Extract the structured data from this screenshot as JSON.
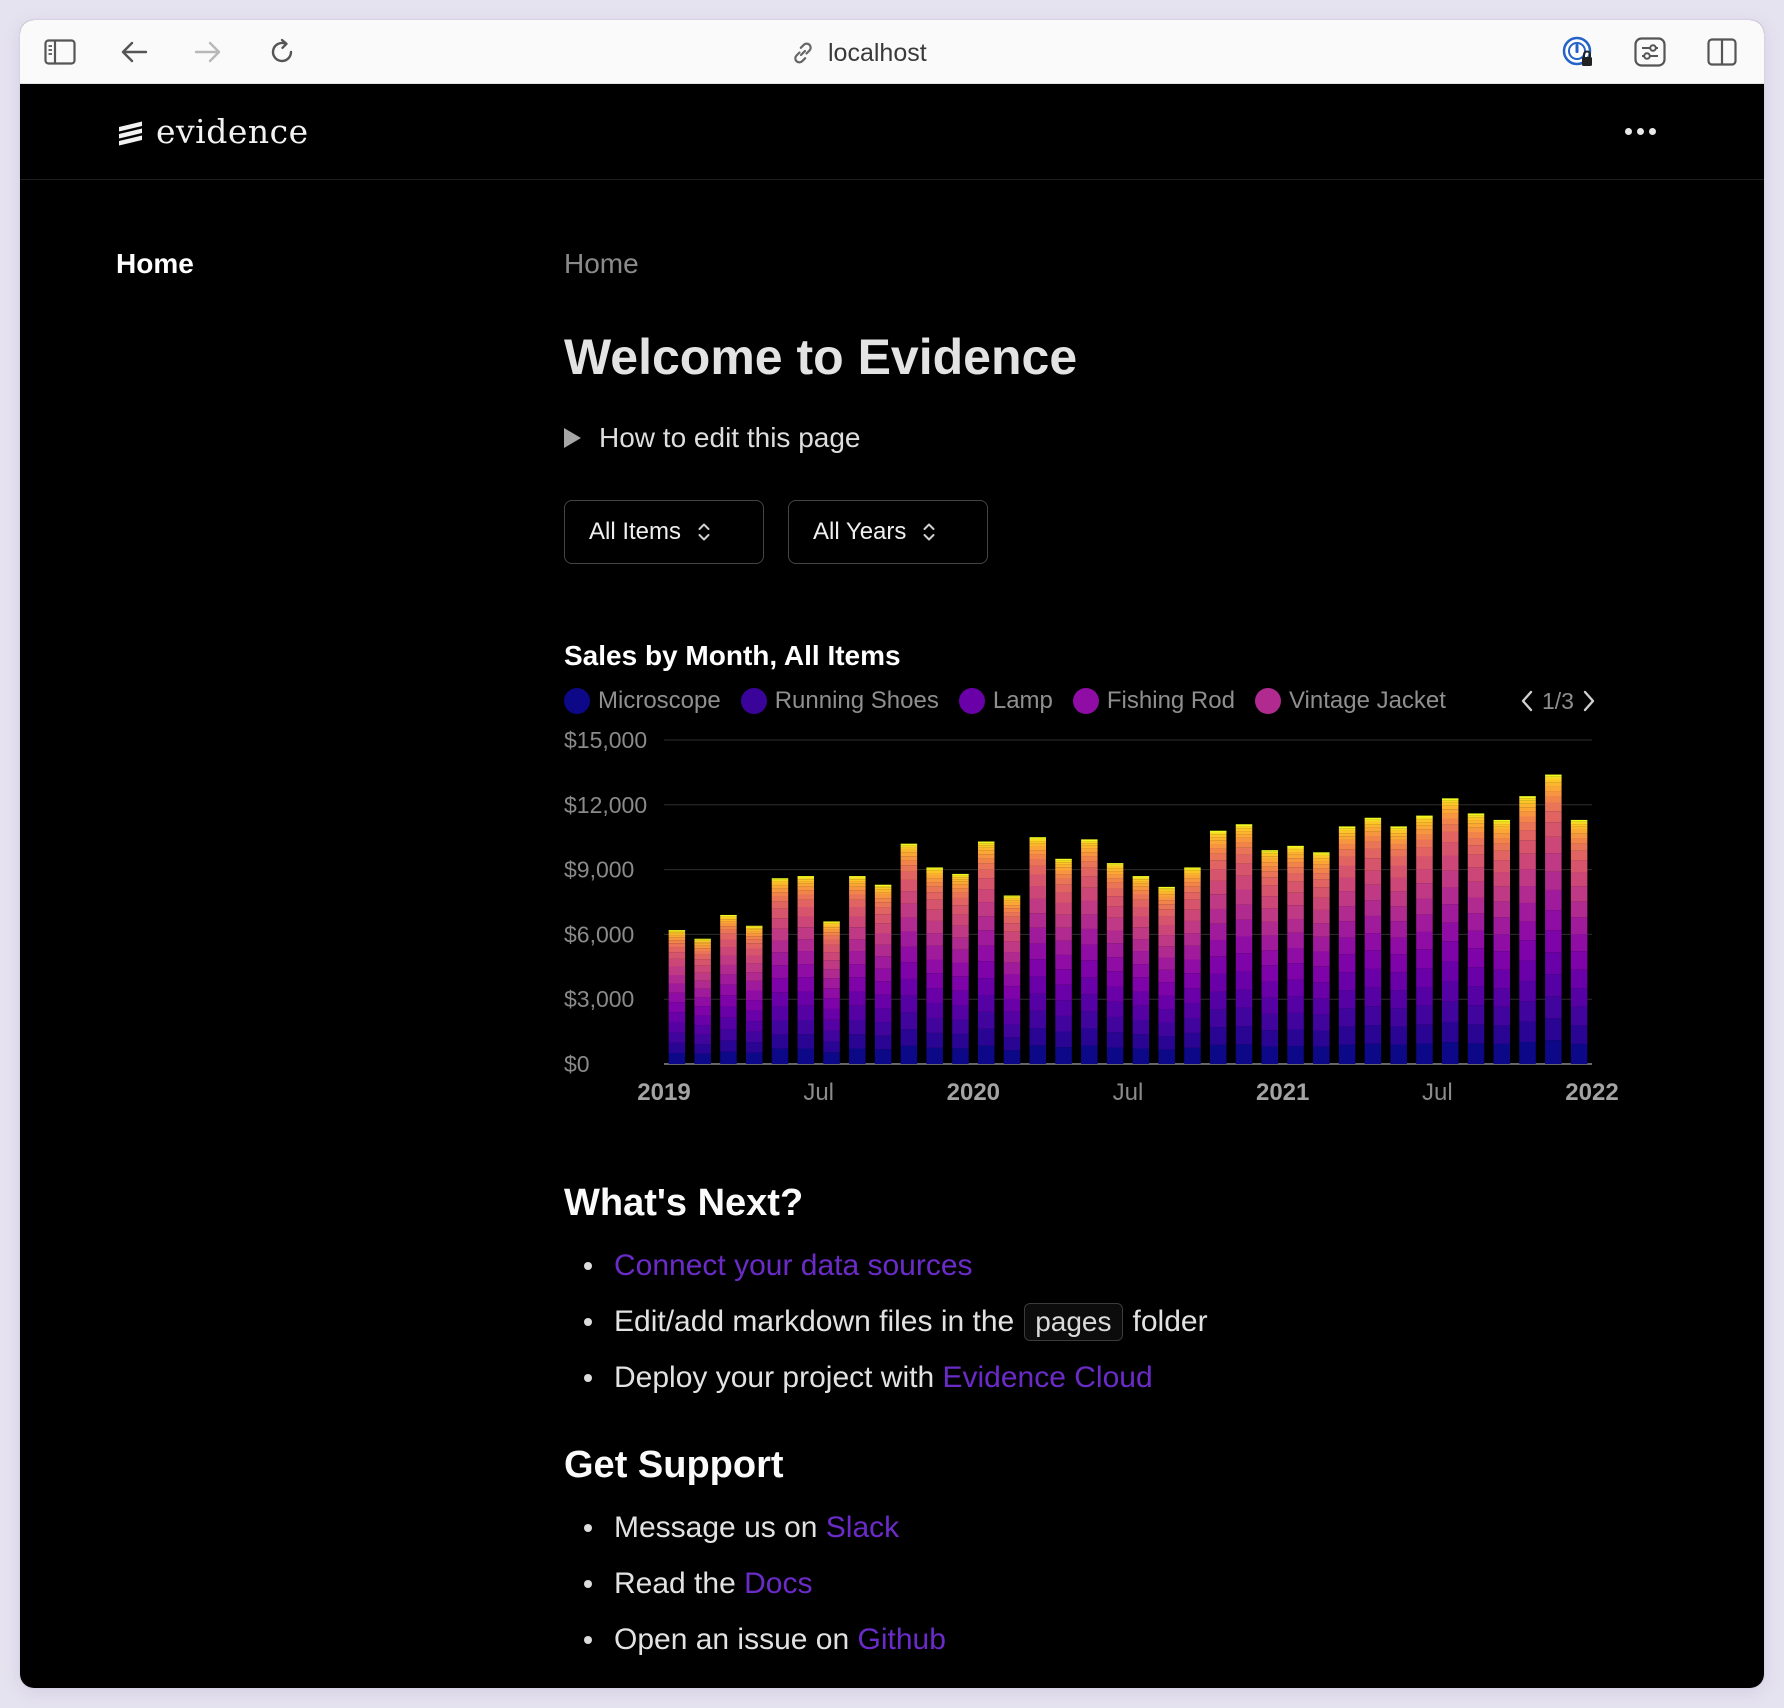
{
  "browser": {
    "url": "localhost",
    "icons": [
      "sidebar-icon",
      "back-arrow-icon",
      "forward-arrow-icon",
      "reload-icon",
      "link-icon",
      "password-manager-icon",
      "extensions-icon",
      "split-view-icon"
    ]
  },
  "header": {
    "logo_text": "evidence"
  },
  "sidebar": {
    "items": [
      {
        "label": "Home"
      }
    ]
  },
  "page": {
    "breadcrumb": "Home",
    "title": "Welcome to Evidence",
    "details_label": "How to edit this page"
  },
  "filters": {
    "items": {
      "label": "All Items"
    },
    "years": {
      "label": "All Years"
    }
  },
  "legend": {
    "items": [
      {
        "label": "Microscope",
        "color": "#0d0887"
      },
      {
        "label": "Running Shoes",
        "color": "#3a049a"
      },
      {
        "label": "Lamp",
        "color": "#6a00a8"
      },
      {
        "label": "Fishing Rod",
        "color": "#8f0da4"
      },
      {
        "label": "Vintage Jacket",
        "color": "#b12a90"
      }
    ],
    "page": "1/3"
  },
  "chart_data": {
    "type": "bar",
    "stacked": true,
    "title": "Sales by Month, All Items",
    "y_ticks": [
      "$15,000",
      "$12,000",
      "$9,000",
      "$6,000",
      "$3,000",
      "$0"
    ],
    "x_ticks": [
      {
        "label": "2019",
        "index": 0,
        "bold": true
      },
      {
        "label": "Jul",
        "index": 6,
        "bold": false
      },
      {
        "label": "2020",
        "index": 12,
        "bold": true
      },
      {
        "label": "Jul",
        "index": 18,
        "bold": false
      },
      {
        "label": "2021",
        "index": 24,
        "bold": true
      },
      {
        "label": "Jul",
        "index": 30,
        "bold": false
      },
      {
        "label": "2022",
        "index": 36,
        "bold": true
      }
    ],
    "ylim": [
      0,
      15000
    ],
    "grid": true,
    "months": 36,
    "totals": [
      6200,
      5800,
      6900,
      6400,
      8600,
      8700,
      6600,
      8700,
      8300,
      10200,
      9100,
      8800,
      10300,
      7800,
      10500,
      9500,
      10400,
      9300,
      8700,
      8200,
      9100,
      10800,
      11100,
      9900,
      10100,
      9800,
      11000,
      11400,
      11000,
      11500,
      12300,
      11600,
      11300,
      12400,
      13400,
      11300
    ],
    "segment_colors": [
      "#0d0887",
      "#2a0593",
      "#41049d",
      "#5601a4",
      "#6a00a8",
      "#7e03a8",
      "#8f0da4",
      "#a01a9c",
      "#b12a90",
      "#bf3984",
      "#cc4778",
      "#d6556d",
      "#e16462",
      "#ea7457",
      "#f2844b",
      "#f89540",
      "#fca636",
      "#fdb42f",
      "#fdc527",
      "#f9d824",
      "#f0f921"
    ],
    "segment_weights": [
      1.3,
      1.2,
      1.2,
      1.2,
      1.2,
      1.2,
      1.1,
      1.1,
      1.0,
      1.0,
      0.9,
      0.8,
      0.6,
      0.45,
      0.35,
      0.3,
      0.25,
      0.2,
      0.18,
      0.15,
      0.12
    ]
  },
  "whats_next": {
    "heading": "What's Next?",
    "item1": {
      "link": "Connect your data sources"
    },
    "item2": {
      "prefix": "Edit/add markdown files in the",
      "code": "pages",
      "suffix": "folder"
    },
    "item3": {
      "prefix": "Deploy your project with",
      "link": "Evidence Cloud"
    }
  },
  "support": {
    "heading": "Get Support",
    "item1": {
      "prefix": "Message us on",
      "link": "Slack"
    },
    "item2": {
      "prefix": "Read the",
      "link": "Docs"
    },
    "item3": {
      "prefix": "Open an issue on",
      "link": "Github"
    }
  }
}
